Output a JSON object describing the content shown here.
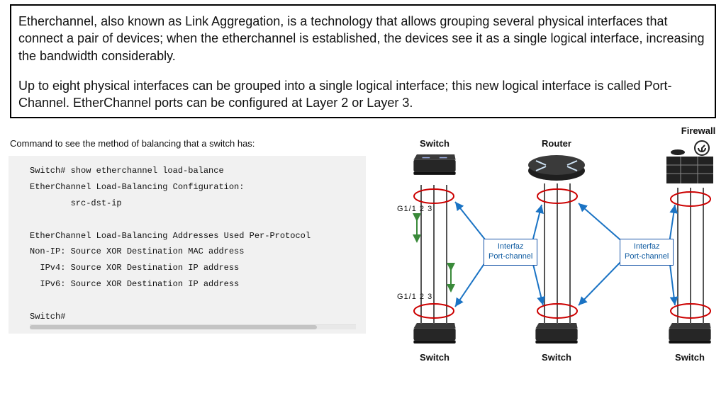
{
  "definition": {
    "p1": "Etherchannel, also known as Link Aggregation, is a technology that allows grouping several physical interfaces that connect a pair of devices; when the etherchannel is established, the devices see it as a single logical interface, increasing the bandwidth considerably.",
    "p2": "Up to eight physical interfaces can be grouped into a single logical interface; this new logical interface is called Port-Channel. EtherChannel ports can be configured at Layer 2 or Layer 3."
  },
  "caption": "Command to see the method of balancing that a switch has:",
  "terminal": {
    "l1": "Switch# show etherchannel load-balance",
    "l2": "EtherChannel Load-Balancing Configuration:",
    "l3": "        src-dst-ip",
    "l4": "",
    "l5": "EtherChannel Load-Balancing Addresses Used Per-Protocol",
    "l6": "Non-IP: Source XOR Destination MAC address",
    "l7": "  IPv4: Source XOR Destination IP address",
    "l8": "  IPv6: Source XOR Destination IP address",
    "l9": "",
    "l10": "Switch#"
  },
  "diagram": {
    "labels": {
      "switch": "Switch",
      "router": "Router",
      "firewall": "Firewall"
    },
    "port_label_top": "G1/1  2  3",
    "port_label_bottom": "G1/1  2  3",
    "callout": {
      "line1": "Interfaz",
      "line2": "Port-channel"
    },
    "colors": {
      "callout_border": "#1a56a8",
      "callout_text": "#0e5aa0",
      "ring": "#c00",
      "arrow": "#1a73c4",
      "arrow_green": "#3a8a3a"
    }
  }
}
